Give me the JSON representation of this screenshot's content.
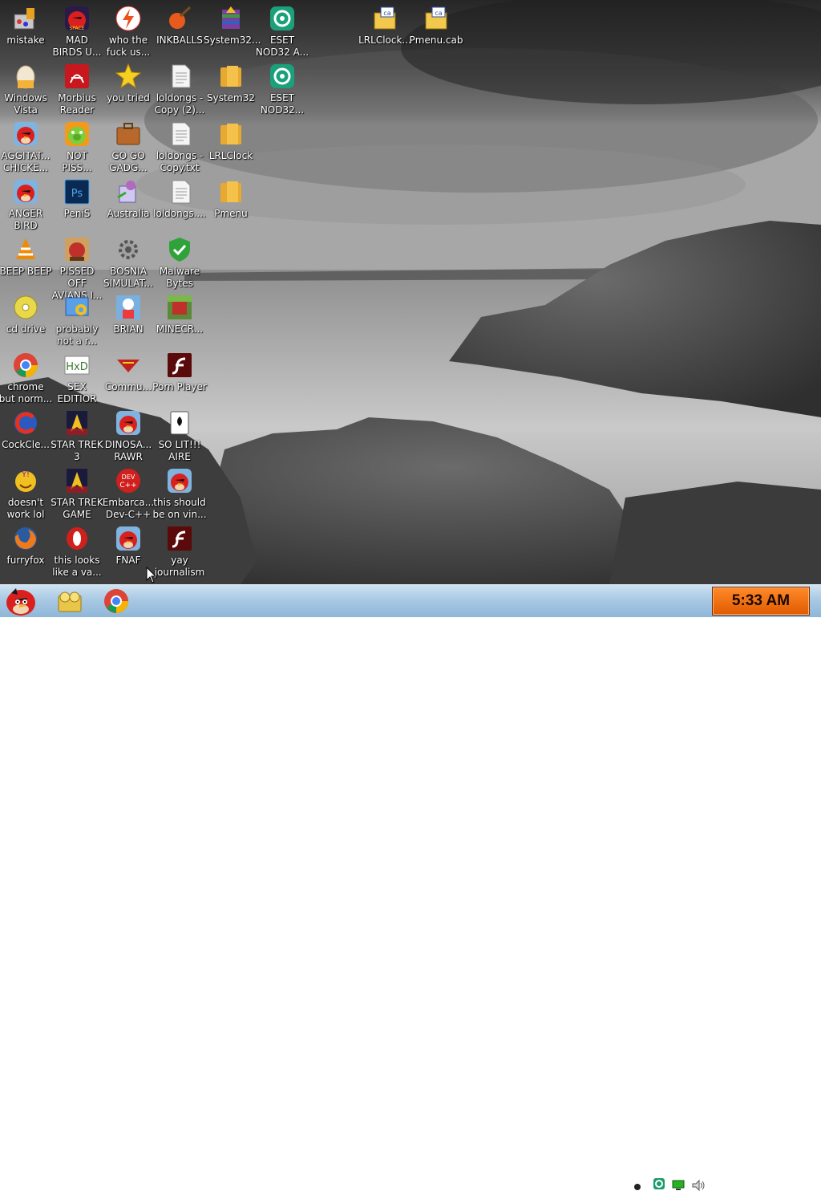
{
  "desktop_icons": [
    {
      "label": "mistake",
      "icon": "paint-box-icon"
    },
    {
      "label": "MAD\nBIRDS U...",
      "icon": "angry-birds-space-icon"
    },
    {
      "label": "who the\nfuck us...",
      "icon": "lightning-icon"
    },
    {
      "label": "INKBALLS",
      "icon": "inkball-icon"
    },
    {
      "label": "System32...",
      "icon": "winrar-icon"
    },
    {
      "label": "ESET\nNOD32 A...",
      "icon": "eset-icon"
    },
    {
      "label": "LRLClock...",
      "icon": "cab-icon"
    },
    {
      "label": "Pmenu.cab",
      "icon": "cab-icon"
    },
    {
      "label": "Windows\nVista",
      "icon": "egg-icon"
    },
    {
      "label": "Morbius\nReader",
      "icon": "pdf-reader-icon"
    },
    {
      "label": "you tried",
      "icon": "star-icon"
    },
    {
      "label": "loldongs -\nCopy (2)...",
      "icon": "text-file-icon"
    },
    {
      "label": "System32",
      "icon": "folder-icon"
    },
    {
      "label": "ESET\nNOD32...",
      "icon": "eset-icon"
    },
    {
      "label": "AGGITAT...\nCHICKE...",
      "icon": "angry-bird-icon"
    },
    {
      "label": "NOT\nPISS...",
      "icon": "pig-icon"
    },
    {
      "label": "GO GO\nGADG...",
      "icon": "briefcase-icon"
    },
    {
      "label": "loldongs -\nCopy.txt",
      "icon": "text-file-icon"
    },
    {
      "label": "LRLClock",
      "icon": "folder-icon"
    },
    {
      "label": "ANGER\nBIRD",
      "icon": "angry-bird-icon"
    },
    {
      "label": "PeniS",
      "icon": "photoshop-icon"
    },
    {
      "label": "Australia",
      "icon": "installer-icon"
    },
    {
      "label": "loldongs....",
      "icon": "text-file-icon"
    },
    {
      "label": "Pmenu",
      "icon": "folder-icon"
    },
    {
      "label": "BEEP BEEP",
      "icon": "vlc-cone-icon"
    },
    {
      "label": "PISSED OFF\nAVIANS I...",
      "icon": "bird-game-icon"
    },
    {
      "label": "BOSNIA\nSIMULAT...",
      "icon": "gear-icon"
    },
    {
      "label": "Malware\nBytes",
      "icon": "shield-icon"
    },
    {
      "label": "cd drive",
      "icon": "cd-icon"
    },
    {
      "label": "probably\nnot a r...",
      "icon": "control-panel-icon"
    },
    {
      "label": "BRIAN",
      "icon": "character-icon"
    },
    {
      "label": "MINECR...",
      "icon": "minecraft-icon"
    },
    {
      "label": "chrome\nbut norm...",
      "icon": "chrome-icon"
    },
    {
      "label": "SEX\nEDITIOR",
      "icon": "hxd-icon"
    },
    {
      "label": "Commu...",
      "icon": "ussr-icon"
    },
    {
      "label": "Porn Player",
      "icon": "flash-icon"
    },
    {
      "label": "CockCle...",
      "icon": "ccleaner-icon"
    },
    {
      "label": "STAR TREK\n3",
      "icon": "star-trek-icon"
    },
    {
      "label": "DINOSA...\nRAWR",
      "icon": "angry-bird-icon"
    },
    {
      "label": "SO LIT!!!\nAIRE",
      "icon": "solitaire-icon"
    },
    {
      "label": "doesn't\nwork lol",
      "icon": "yahoo-icon"
    },
    {
      "label": "STAR TREK\nGAME",
      "icon": "star-trek-icon"
    },
    {
      "label": "Embarca...\nDev-C++",
      "icon": "devcpp-icon"
    },
    {
      "label": "this should\nbe on vin...",
      "icon": "angry-bird-icon"
    },
    {
      "label": "furryfox",
      "icon": "firefox-icon"
    },
    {
      "label": "this looks\nlike a va...",
      "icon": "opera-icon"
    },
    {
      "label": "FNAF",
      "icon": "angry-bird-icon"
    },
    {
      "label": "yay\njournalism",
      "icon": "flash-icon"
    }
  ],
  "taskbar": {
    "start_icon": "angry-bird-start-icon",
    "pinned": [
      "file-explorer-icon",
      "chrome-icon"
    ],
    "tray_icons": [
      "action-center-icon",
      "eset-tray-icon",
      "network-icon",
      "volume-icon"
    ],
    "clock": "5:33 AM"
  }
}
